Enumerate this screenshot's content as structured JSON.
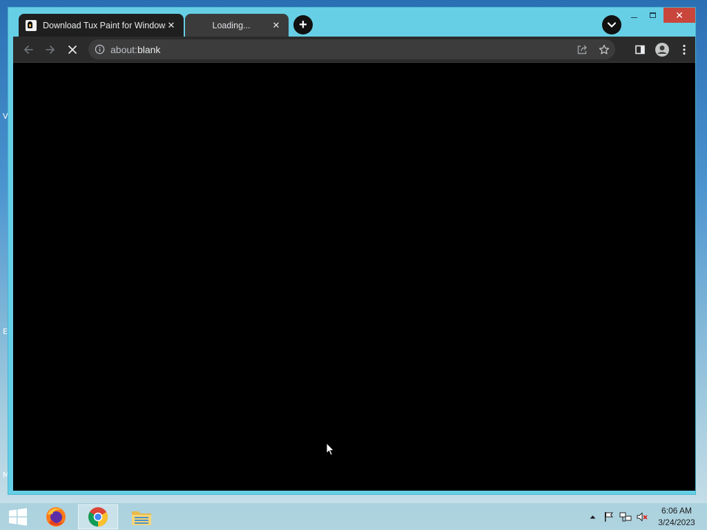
{
  "desktop": {
    "edge_glyphs": [
      "V",
      "E",
      "M"
    ]
  },
  "window": {
    "frame_color": "#66cfe6",
    "controls": {
      "minimize_label": "",
      "maximize_label": "",
      "close_label": "✕"
    }
  },
  "tabs": [
    {
      "title": "Download Tux Paint for Windows",
      "active": true,
      "close_glyph": "✕"
    },
    {
      "title": "Loading...",
      "active": false,
      "close_glyph": "✕"
    }
  ],
  "new_tab_glyph": "+",
  "toolbar": {
    "address": {
      "scheme": "about:",
      "host": "blank"
    },
    "icons": [
      "back-icon",
      "forward-icon",
      "stop-icon",
      "site-info-icon",
      "share-icon",
      "bookmark-star-icon",
      "side-panel-icon",
      "profile-icon",
      "menu-icon"
    ]
  },
  "viewport": {
    "background": "#000000"
  },
  "taskbar": {
    "apps": [
      "firefox-icon",
      "chrome-icon",
      "file-explorer-icon"
    ],
    "active_app": "chrome-icon",
    "clock": {
      "time": "6:06 AM",
      "date": "3/24/2023"
    },
    "tray": [
      "show-hidden-icons-icon",
      "action-center-flag-icon",
      "network-icon",
      "volume-muted-icon"
    ]
  }
}
